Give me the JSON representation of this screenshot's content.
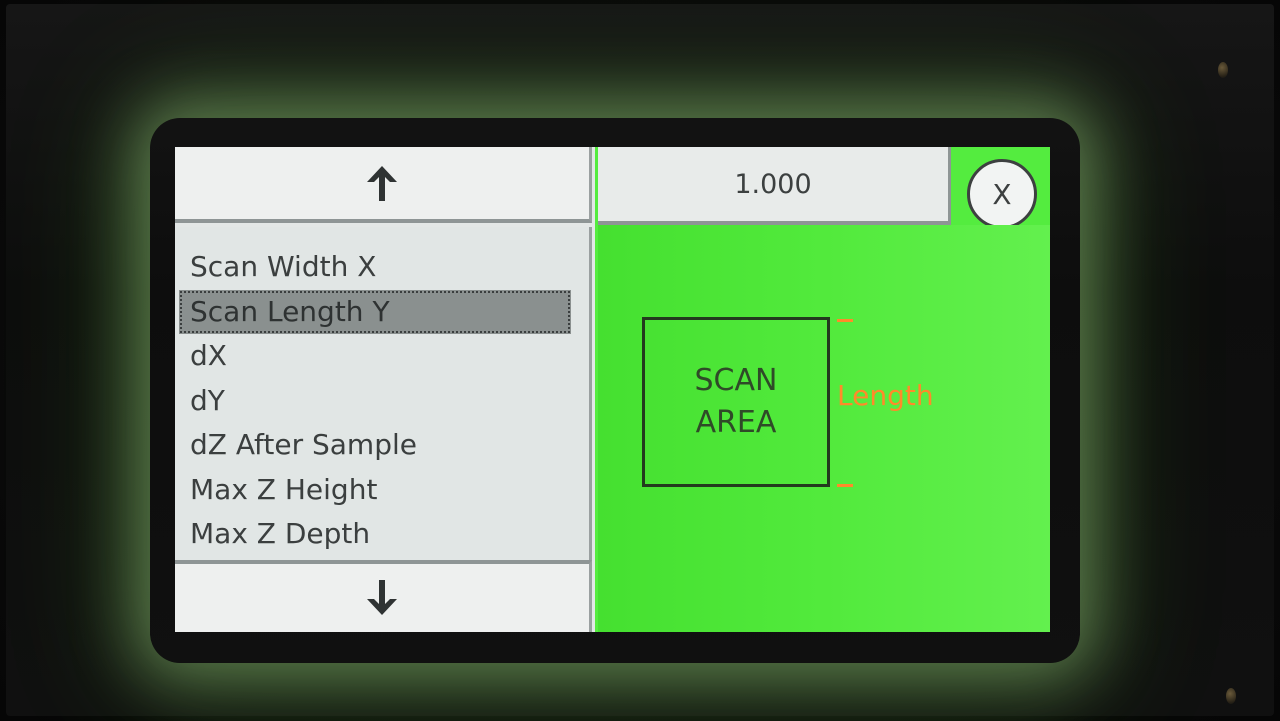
{
  "nav": {
    "up_icon": "arrow-up-icon",
    "down_icon": "arrow-down-icon"
  },
  "value_field": {
    "value": "1.000"
  },
  "close_button": {
    "label": "X"
  },
  "param_list": {
    "items": [
      {
        "label": "Scan Width X",
        "selected": false
      },
      {
        "label": "Scan Length Y",
        "selected": true
      },
      {
        "label": "dX",
        "selected": false
      },
      {
        "label": "dY",
        "selected": false
      },
      {
        "label": "dZ After Sample",
        "selected": false
      },
      {
        "label": "Max Z Height",
        "selected": false
      },
      {
        "label": "Max Z Depth",
        "selected": false
      }
    ]
  },
  "diagram": {
    "box_line1": "SCAN",
    "box_line2": "AREA",
    "dimension_label": "Length"
  },
  "colors": {
    "screen_green": "#54ec3f",
    "accent_orange": "#ff8a2a",
    "panel_gray": "#e3e7e6",
    "selected_gray": "#8a908f"
  }
}
